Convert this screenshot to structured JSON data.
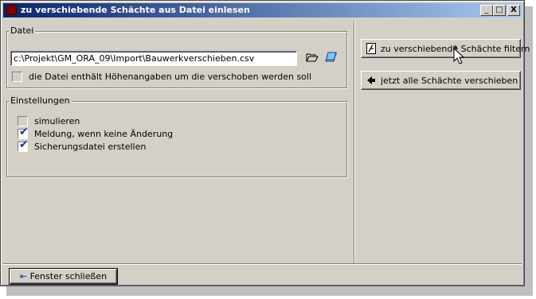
{
  "window": {
    "title": "zu verschiebende Schächte aus Datei einlesen",
    "controls": {
      "minimize": "_",
      "maximize": "□",
      "close": "X"
    }
  },
  "file_group": {
    "label": "Datei",
    "path_value": "c:\\Projekt\\GM_ORA_09\\Import\\Bauwerkverschieben.csv",
    "height_checkbox": {
      "label": "die Datei enthält Höhenangaben um die verschoben werden soll",
      "checked": false
    }
  },
  "settings_group": {
    "label": "Einstellungen",
    "options": [
      {
        "label": "simulieren",
        "checked": false
      },
      {
        "label": "Meldung, wenn keine Änderung",
        "checked": true
      },
      {
        "label": "Sicherungsdatei erstellen",
        "checked": true
      }
    ]
  },
  "actions": {
    "filter_label": "zu verschiebende Schächte filtern",
    "move_label": "jetzt alle Schächte verschieben"
  },
  "footer": {
    "close_label": "Fenster schließen"
  },
  "colors": {
    "titlebar_start": "#0a246a",
    "titlebar_end": "#a6caf0",
    "face": "#d4d0c8",
    "checkmark": "#1a3a9a"
  }
}
